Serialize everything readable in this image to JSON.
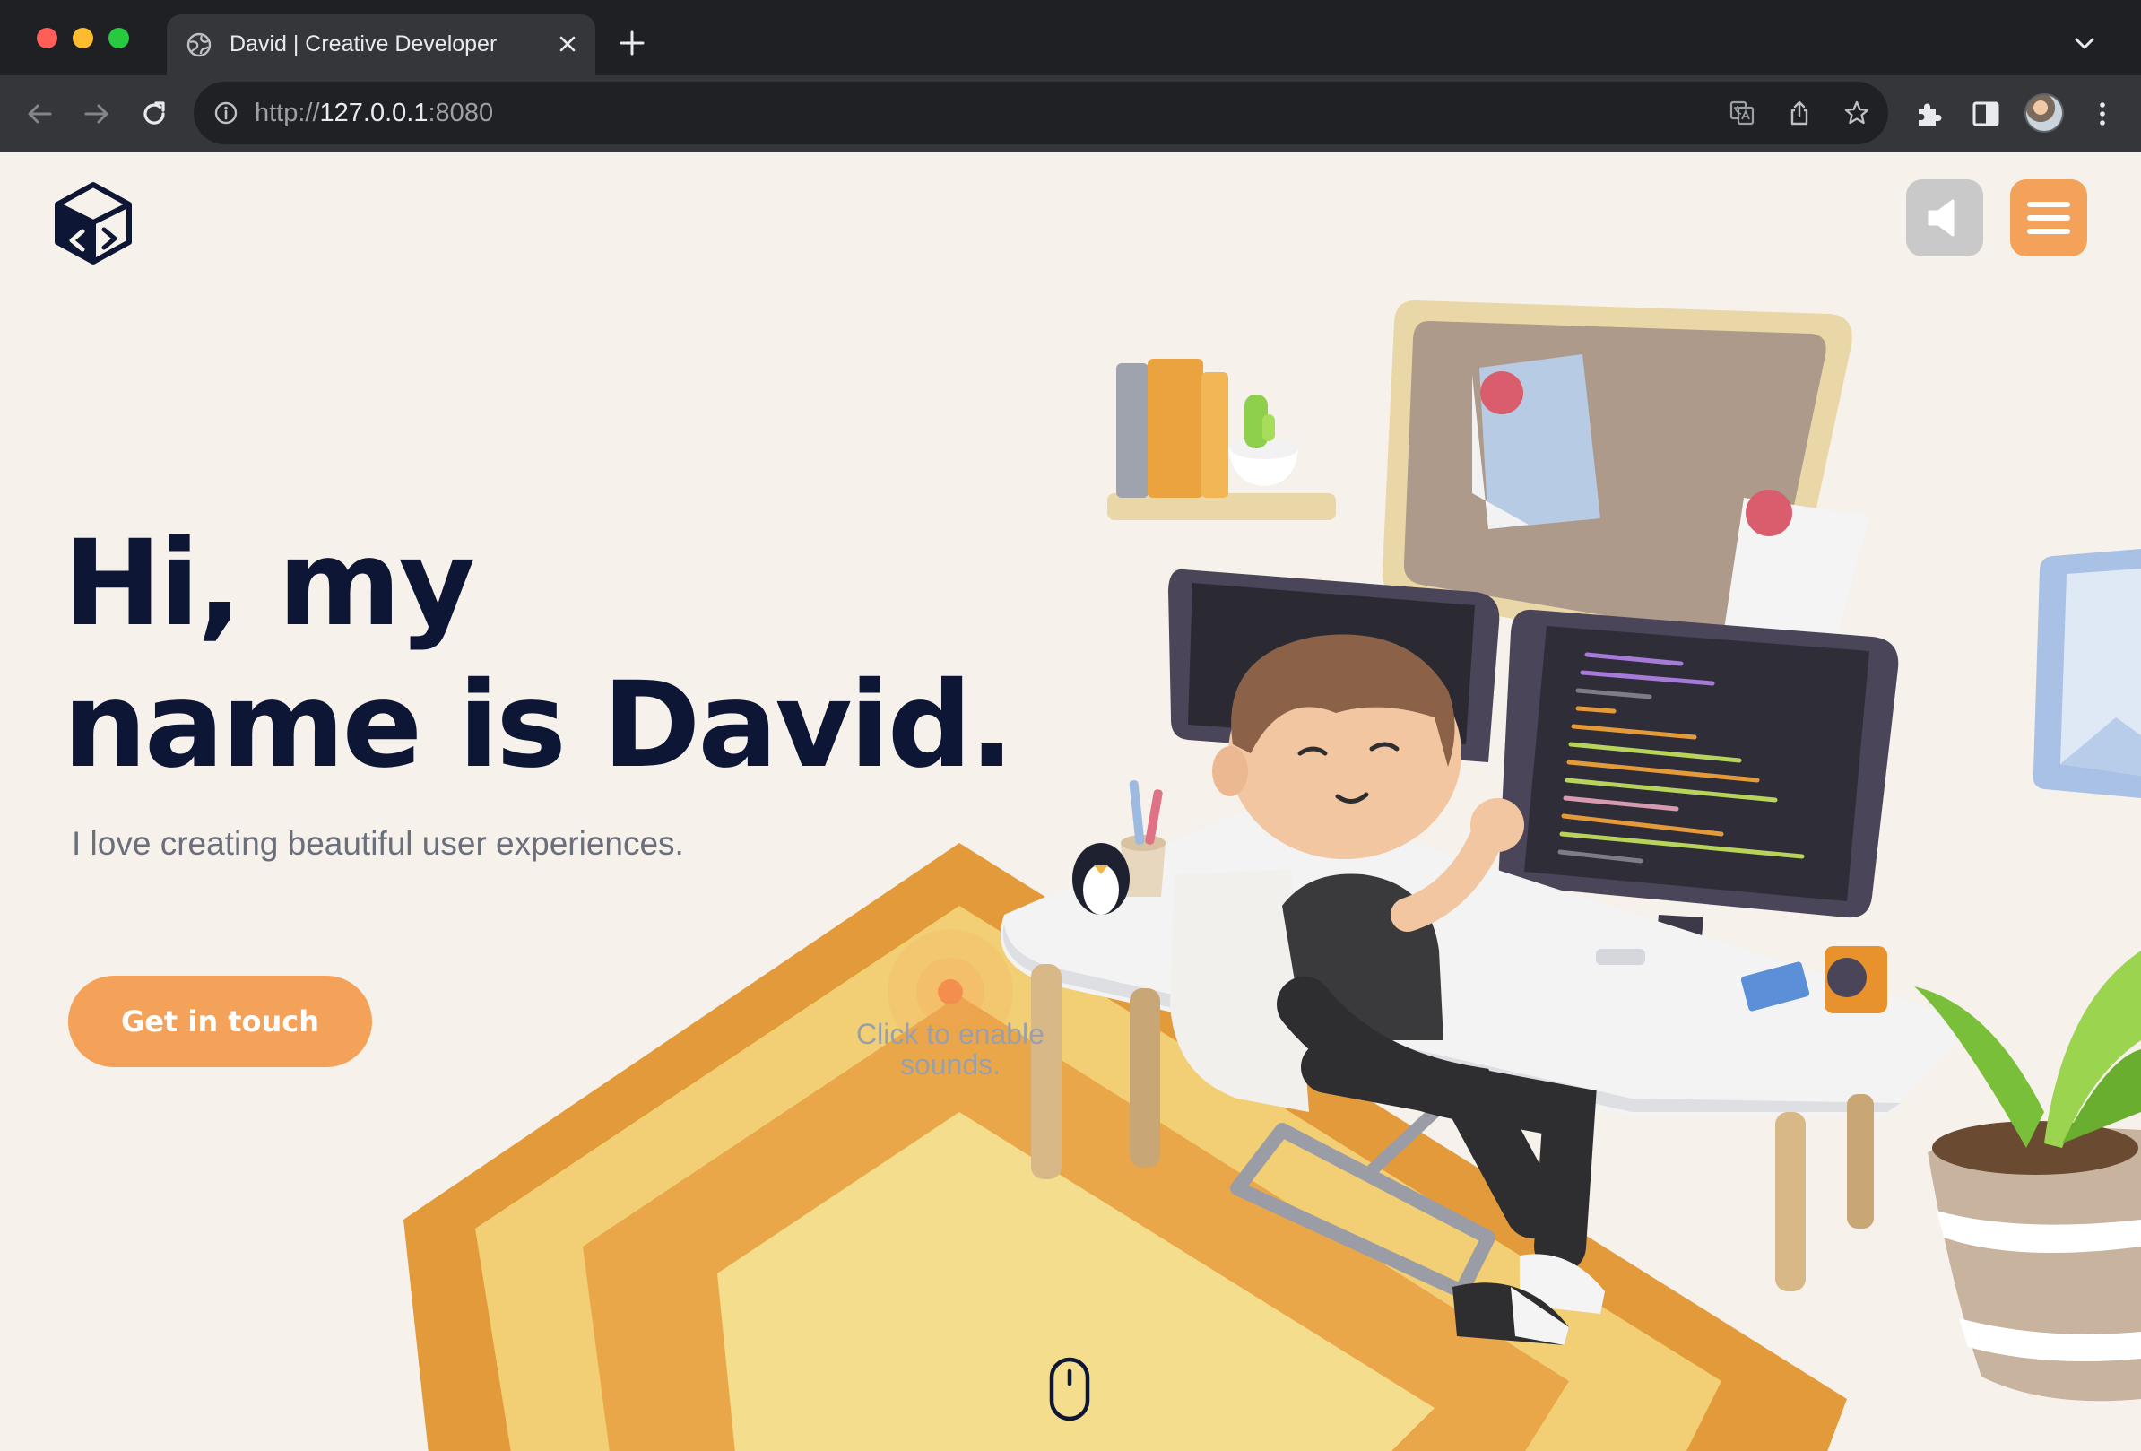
{
  "browser": {
    "tab_title": "David | Creative Developer",
    "url_scheme": "http://",
    "url_host": "127.0.0.1",
    "url_port": ":8080"
  },
  "page": {
    "hero_line1": "Hi, my",
    "hero_line2": "name is David.",
    "subtitle": "I love creating beautiful user experiences.",
    "cta_label": "Get in touch",
    "sound_hint_line1": "Click to enable",
    "sound_hint_line2": "sounds."
  },
  "icons": {
    "logo": "cube-code-logo",
    "sound": "speaker-icon",
    "menu": "hamburger-icon",
    "scroll": "mouse-scroll-icon"
  },
  "colors": {
    "background": "#f6f1ea",
    "accent": "#f4a259",
    "heading": "#0d1634",
    "body_text": "#6b6f7b"
  }
}
